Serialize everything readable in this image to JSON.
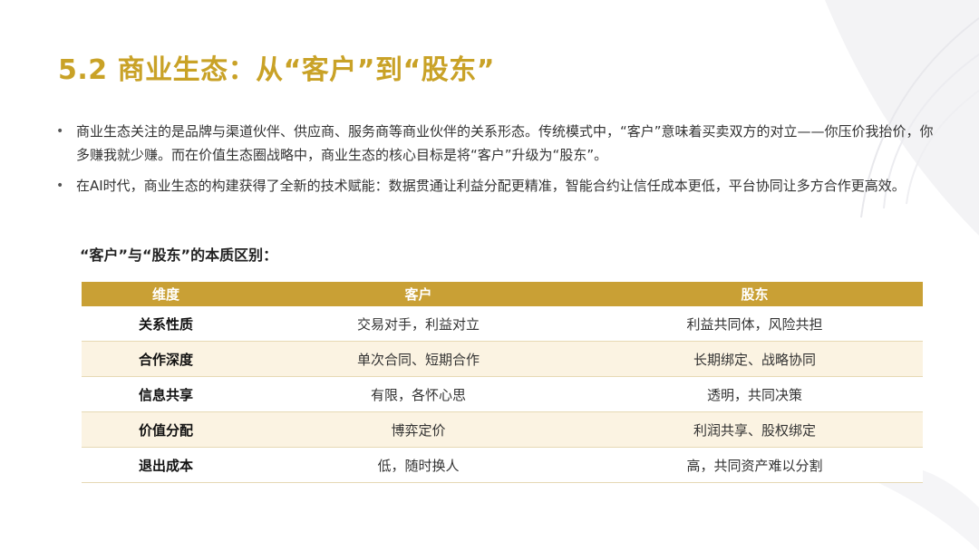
{
  "slide": {
    "title": "5.2 商业生态：从“客户”到“股东”",
    "bullets": [
      "商业生态关注的是品牌与渠道伙伴、供应商、服务商等商业伙伴的关系形态。传统模式中，“客户”意味着买卖双方的对立——你压价我抬价，你多赚我就少赚。而在价值生态圈战略中，商业生态的核心目标是将“客户”升级为“股东”。",
      "在AI时代，商业生态的构建获得了全新的技术赋能：数据贯通让利益分配更精准，智能合约让信任成本更低，平台协同让多方合作更高效。"
    ],
    "bullet_glyph": "•",
    "subtitle": "“客户”与“股东”的本质区别："
  },
  "table": {
    "headers": [
      "维度",
      "客户",
      "股东"
    ],
    "rows": [
      [
        "关系性质",
        "交易对手，利益对立",
        "利益共同体，风险共担"
      ],
      [
        "合作深度",
        "单次合同、短期合作",
        "长期绑定、战略协同"
      ],
      [
        "信息共享",
        "有限，各怀心思",
        "透明，共同决策"
      ],
      [
        "价值分配",
        "博弈定价",
        "利润共享、股权绑定"
      ],
      [
        "退出成本",
        "低，随时换人",
        "高，共同资产难以分割"
      ]
    ]
  },
  "colors": {
    "accent": "#c9a227",
    "header_bg": "#c9a035",
    "stripe_bg": "#fbf3e2"
  }
}
